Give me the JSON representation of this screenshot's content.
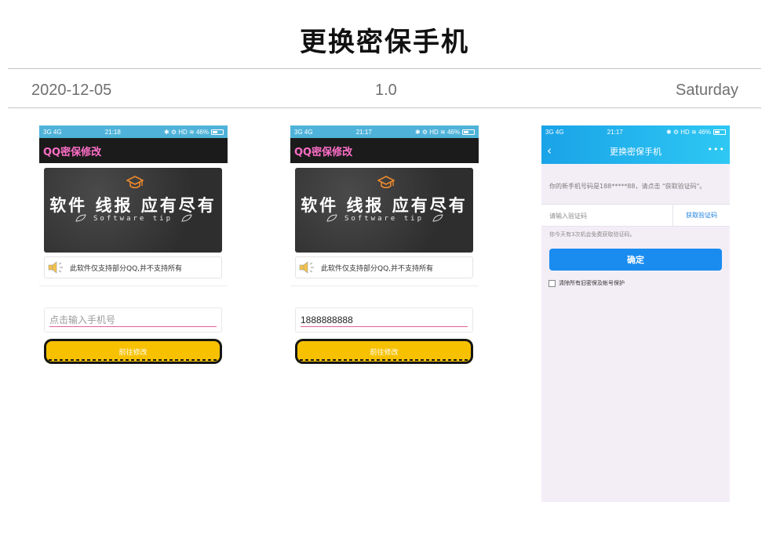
{
  "page": {
    "title": "更换密保手机",
    "date": "2020-12-05",
    "version": "1.0",
    "weekday": "Saturday"
  },
  "colors": {
    "status_bar": "#4fb3d9",
    "app_bar": "#1b1b1b",
    "app_title": "#ff6fc8",
    "button_yellow": "#f7c100",
    "qq_header_gradient": [
      "#1aa3e8",
      "#2ec8f3"
    ],
    "qq_background": "#f3eef6",
    "qq_confirm": "#1a8cf0",
    "input_underline": "#e0609a"
  },
  "screens": [
    {
      "status": {
        "left": "3G 4G",
        "time": "21:18",
        "right": "✱ ⚙ HD ≋ 46%"
      },
      "app_title": "QQ密保修改",
      "banner": {
        "title": "软件 线报 应有尽有",
        "subtitle": "Software tip",
        "icon": "graduation-cap-icon"
      },
      "notice": {
        "text": "此软件仅支持部分QQ,并不支持所有",
        "icon": "speaker-icon"
      },
      "phone_field": {
        "value": "",
        "placeholder": "点击输入手机号"
      },
      "button_label": "前往修改"
    },
    {
      "status": {
        "left": "3G 4G",
        "time": "21:17",
        "right": "✱ ⚙ HD ≋ 46%"
      },
      "app_title": "QQ密保修改",
      "banner": {
        "title": "软件 线报 应有尽有",
        "subtitle": "Software tip",
        "icon": "graduation-cap-icon"
      },
      "notice": {
        "text": "此软件仅支持部分QQ,并不支持所有",
        "icon": "speaker-icon"
      },
      "phone_field": {
        "value": "1888888888",
        "placeholder": "点击输入手机号"
      },
      "button_label": "前往修改"
    },
    {
      "status": {
        "left": "3G 4G",
        "time": "21:17",
        "right": "✱ ⚙ HD ≋ 46%"
      },
      "header_title": "更换密保手机",
      "back_icon": "back-chevron-icon",
      "more_icon": "more-dots-icon",
      "info_text": "你的新手机号码是188*****88，请点击 \"获取验证码\"。",
      "code_field": {
        "value": "",
        "placeholder": "请输入验证码"
      },
      "get_code_label": "获取验证码",
      "hint": "你今天有3次机会免费获取验证码。",
      "confirm_label": "确定",
      "clear_option": {
        "label": "清除所有旧密保及帐号保护",
        "checked": false
      }
    }
  ]
}
